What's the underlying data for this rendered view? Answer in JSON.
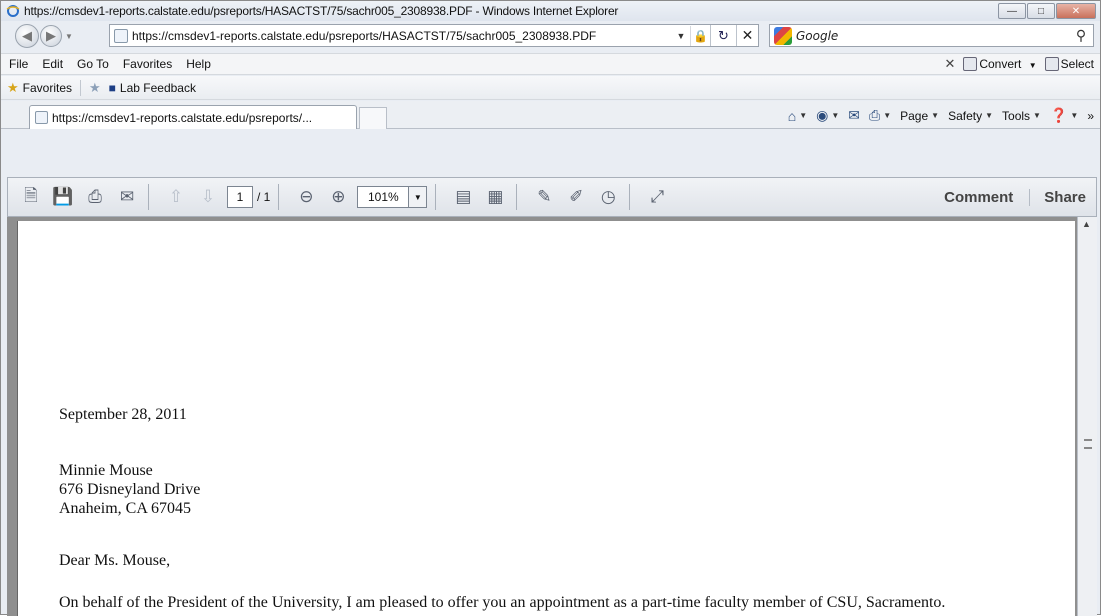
{
  "window": {
    "title": "https://cmsdev1-reports.calstate.edu/psreports/HASACTST/75/sachr005_2308938.PDF - Windows Internet Explorer"
  },
  "address_bar": {
    "url": "https://cmsdev1-reports.calstate.edu/psreports/HASACTST/75/sachr005_2308938.PDF"
  },
  "search": {
    "placeholder": "Google"
  },
  "menu": {
    "items": [
      "File",
      "Edit",
      "Go To",
      "Favorites",
      "Help"
    ],
    "convert_label": "Convert",
    "select_label": "Select"
  },
  "favorites_bar": {
    "favorites_label": "Favorites",
    "items": [
      "Lab Feedback"
    ]
  },
  "tab": {
    "label": "https://cmsdev1-reports.calstate.edu/psreports/..."
  },
  "command_bar": {
    "page_label": "Page",
    "safety_label": "Safety",
    "tools_label": "Tools"
  },
  "pdf_toolbar": {
    "current_page": "1",
    "page_count": "/ 1",
    "zoom": "101%",
    "comment_label": "Comment",
    "share_label": "Share"
  },
  "document": {
    "date": "September 28, 2011",
    "recipient_name": "Minnie  Mouse",
    "address_line1": "676 Disneyland Drive",
    "address_line2": "Anaheim, CA 67045",
    "salutation": "Dear Ms. Mouse,",
    "body_line1": "On behalf of the President of the University, I am pleased to offer you an appointment as a part-time faculty member of CSU, Sacramento."
  }
}
